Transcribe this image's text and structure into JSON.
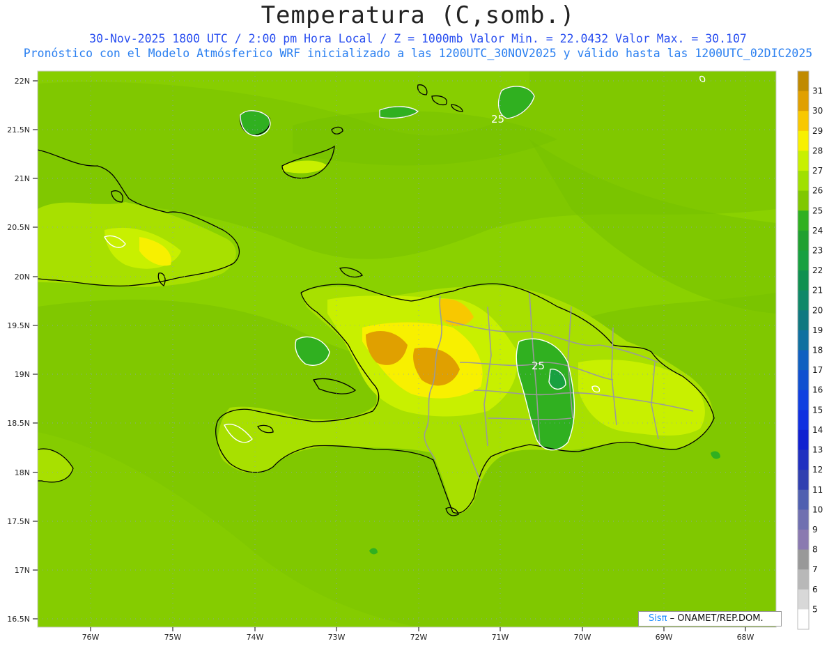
{
  "header": {
    "title": "Temperatura (C,somb.)",
    "line1": "30-Nov-2025  1800 UTC / 2:00 pm Hora Local / Z = 1000mb    Valor Min. = 22.0432  Valor Max. = 30.107",
    "line2": "Pronóstico con el Modelo Atmósferico WRF inicializado a las 1200UTC_30NOV2025 y válido hasta las  1200UTC_02DIC2025"
  },
  "axes": {
    "lat_labels": [
      "22N",
      "21.5N",
      "21N",
      "20.5N",
      "20N",
      "19.5N",
      "19N",
      "18.5N",
      "18N",
      "17.5N",
      "17N",
      "16.5N"
    ],
    "lon_labels": [
      "76W",
      "75W",
      "74W",
      "73W",
      "72W",
      "71W",
      "70W",
      "69W",
      "68W"
    ]
  },
  "colorbar": {
    "labels": [
      "31",
      "30",
      "29",
      "28",
      "27",
      "26",
      "25",
      "24",
      "23",
      "22",
      "21",
      "20",
      "19",
      "18",
      "17",
      "16",
      "15",
      "14",
      "13",
      "12",
      "11",
      "10",
      "9",
      "8",
      "7",
      "6",
      "5"
    ],
    "colors": [
      "#c08a00",
      "#e0a000",
      "#f8c800",
      "#f8f000",
      "#c8f000",
      "#a0e000",
      "#80c800",
      "#30b020",
      "#20a030",
      "#18a040",
      "#109050",
      "#108868",
      "#107880",
      "#1070a0",
      "#1060c0",
      "#1050d0",
      "#1040e0",
      "#1030e0",
      "#1020d0",
      "#2030c0",
      "#3040b0",
      "#5060b0",
      "#7070b0",
      "#8a7ab0",
      "#999999",
      "#b8b8b8",
      "#d8d8d8",
      "#ffffff"
    ]
  },
  "contour_labels": [
    "25",
    "25"
  ],
  "credit": {
    "brand": "Sisπ",
    "text": "– ONAMET/REP.DOM."
  }
}
